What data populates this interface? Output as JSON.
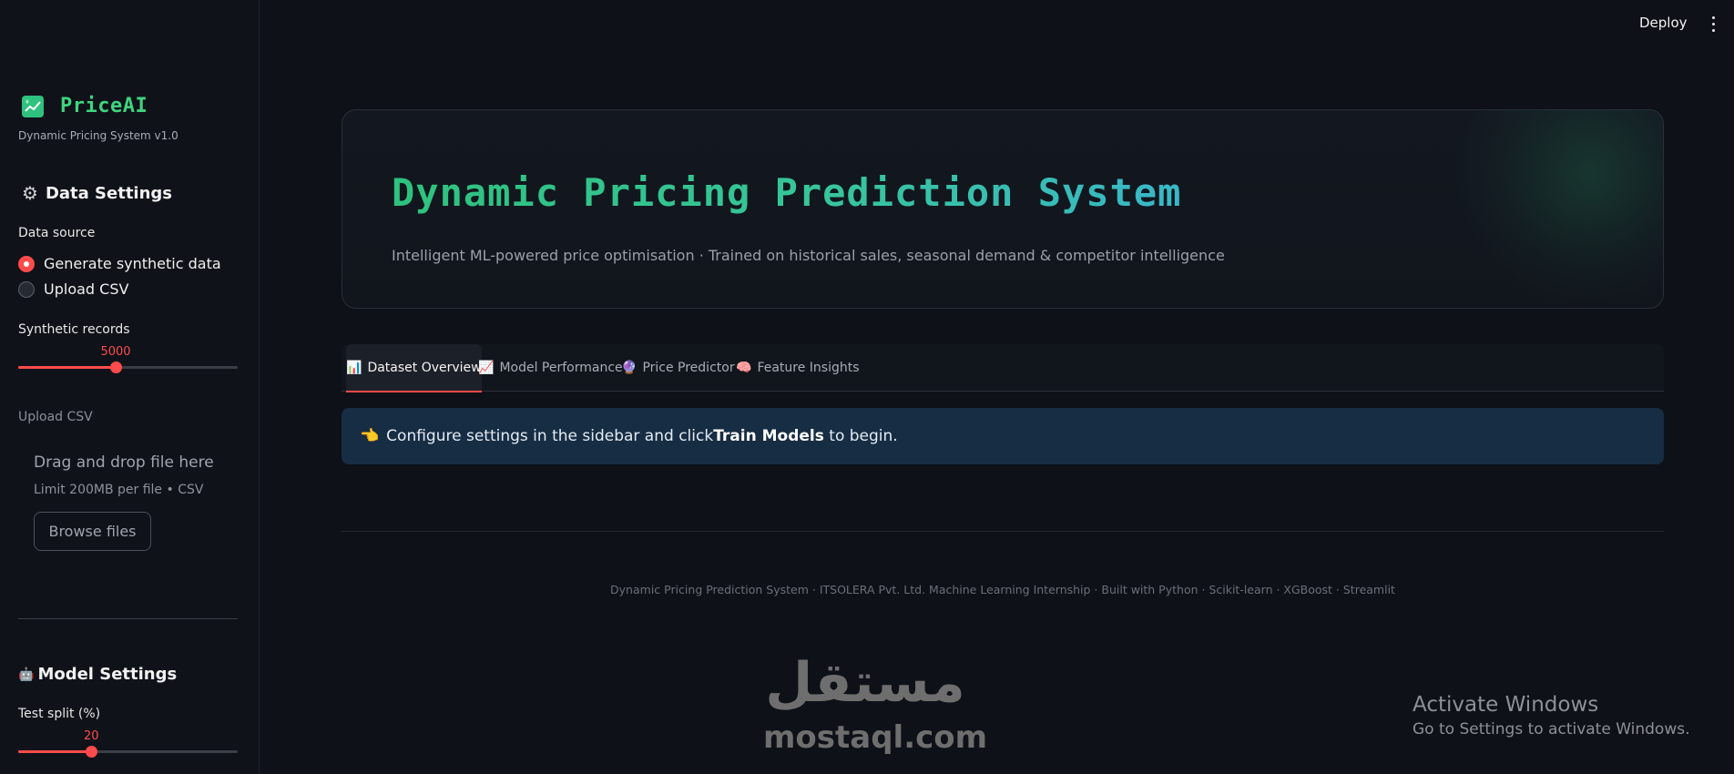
{
  "header": {
    "deploy_label": "Deploy",
    "menu_icon": "kebab-menu-icon"
  },
  "sidebar": {
    "brand": {
      "icon": "chart-icon",
      "name": "PriceAI",
      "subtitle": "Dynamic Pricing System v1.0"
    },
    "data_settings": {
      "title": "Data Settings",
      "icon": "gear-icon",
      "data_source_label": "Data source",
      "options": [
        {
          "label": "Generate synthetic data",
          "selected": true
        },
        {
          "label": "Upload CSV",
          "selected": false
        }
      ],
      "synthetic_records": {
        "label": "Synthetic records",
        "value": "5000",
        "fraction": 0.444
      },
      "upload": {
        "label": "Upload CSV",
        "drop_title": "Drag and drop file here",
        "limit": "Limit 200MB per file • CSV",
        "browse_label": "Browse files"
      }
    },
    "model_settings": {
      "title": "Model Settings",
      "icon": "robot-icon",
      "test_split": {
        "label": "Test split (%)",
        "value": "20",
        "fraction": 0.333
      }
    }
  },
  "hero": {
    "title": "Dynamic Pricing Prediction System",
    "subtitle": "Intelligent ML-powered price optimisation · Trained on historical sales, seasonal demand & competitor intelligence"
  },
  "tabs": [
    {
      "icon": "📊",
      "label": "Dataset Overview",
      "active": true
    },
    {
      "icon": "📈",
      "label": "Model Performance",
      "active": false
    },
    {
      "icon": "🔮",
      "label": "Price Predictor",
      "active": false
    },
    {
      "icon": "🧠",
      "label": "Feature Insights",
      "active": false
    }
  ],
  "info": {
    "icon": "👈",
    "text_before": "Configure settings in the sidebar and click ",
    "bold": "Train Models",
    "text_after": " to begin."
  },
  "footer": {
    "text": "Dynamic Pricing Prediction System  ·  ITSOLERA Pvt. Ltd. Machine Learning Internship  ·  Built with Python · Scikit-learn · XGBoost · Streamlit"
  },
  "watermark": {
    "arabic": "مستقل",
    "latin": "mostaql.com"
  },
  "windows": {
    "title": "Activate Windows",
    "subtitle": "Go to Settings to activate Windows."
  },
  "colors": {
    "accent": "#ff4b4b",
    "brand_green": "#3fd47e",
    "background": "#0e1117",
    "info_bg": "#172d43"
  }
}
